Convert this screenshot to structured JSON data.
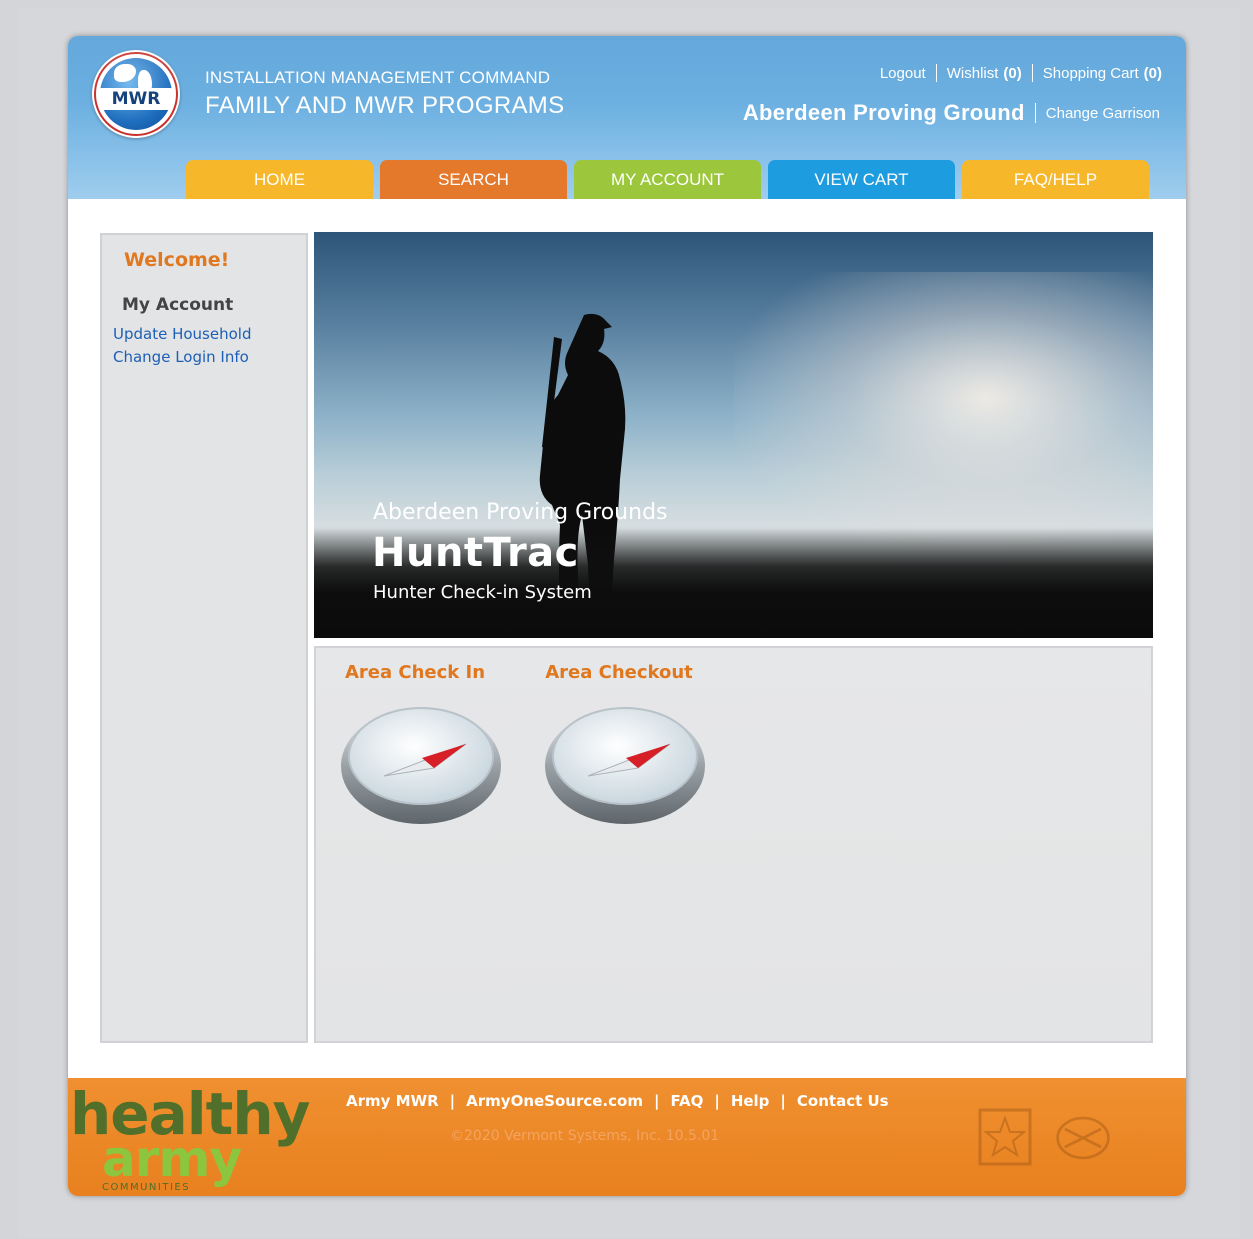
{
  "header": {
    "org_line1": "INSTALLATION MANAGEMENT COMMAND",
    "org_line2": "FAMILY AND MWR PROGRAMS",
    "logo_text": "MWR",
    "logout": "Logout",
    "wishlist": "Wishlist",
    "wishlist_count": "(0)",
    "cart": "Shopping Cart",
    "cart_count": "(0)",
    "garrison": "Aberdeen Proving Ground",
    "change_garrison": "Change Garrison"
  },
  "nav": {
    "tabs": [
      {
        "label": "HOME",
        "color": "#f6b82a"
      },
      {
        "label": "SEARCH",
        "color": "#e4782b"
      },
      {
        "label": "MY ACCOUNT",
        "color": "#9cc73c"
      },
      {
        "label": "VIEW CART",
        "color": "#1d9ce0"
      },
      {
        "label": "FAQ/HELP",
        "color": "#f6b82a"
      }
    ]
  },
  "sidebar": {
    "welcome": "Welcome!",
    "section": "My Account",
    "links": [
      "Update Household",
      "Change Login Info"
    ]
  },
  "hero": {
    "subtitle": "Aberdeen Proving Grounds",
    "title": "HuntTrac",
    "tagline": "Hunter Check-in System"
  },
  "tiles": [
    {
      "label": "Area Check In",
      "icon": "compass-icon"
    },
    {
      "label": "Area Checkout",
      "icon": "compass-icon"
    }
  ],
  "footer": {
    "logo_line1": "healthy",
    "logo_line2": "army",
    "logo_line3": "COMMUNITIES",
    "links": [
      "Army MWR",
      "ArmyOneSource.com",
      "FAQ",
      "Help",
      "Contact Us"
    ],
    "separator": "|",
    "copyright": "©2020 Vermont Systems, Inc. 10.5.01"
  },
  "colors": {
    "accent_orange": "#e0781f",
    "link_blue": "#1d5fb5",
    "header_blue": "#4a9ad6",
    "footer_orange": "#ec8a28"
  }
}
